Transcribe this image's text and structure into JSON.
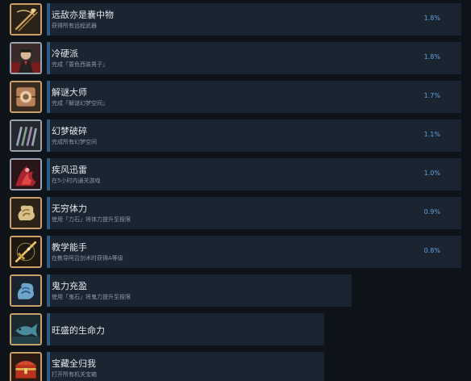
{
  "achievements": [
    {
      "title": "远敌亦是囊中物",
      "desc": "获得所有远程武器",
      "percent": "1.8%",
      "icon": "bow-weapons-icon"
    },
    {
      "title": "冷硬派",
      "desc": "完成「蔷色西装男子」",
      "percent": "1.8%",
      "icon": "man-in-suit-icon"
    },
    {
      "title": "解谜大师",
      "desc": "完成「解谜幻梦空间」",
      "percent": "1.7%",
      "icon": "puzzle-box-icon"
    },
    {
      "title": "幻梦破碎",
      "desc": "完成所有幻梦空间",
      "percent": "1.1%",
      "icon": "crystal-shards-icon"
    },
    {
      "title": "疾风迅雷",
      "desc": "在5小时内通关游戏",
      "percent": "1.0%",
      "icon": "red-flame-warrior-icon"
    },
    {
      "title": "无穷体力",
      "desc": "使用「力石」将体力提升至极限",
      "percent": "0.9%",
      "icon": "stamina-stone-icon"
    },
    {
      "title": "教学能手",
      "desc": "在教导阿吕剑术时获得A等级",
      "percent": "0.8%",
      "icon": "golden-sword-icon"
    },
    {
      "title": "鬼力充盈",
      "desc": "使用「鬼石」将鬼力提升至极限",
      "percent": "",
      "icon": "spirit-stone-icon"
    },
    {
      "title": "旺盛的生命力",
      "desc": "",
      "percent": "",
      "icon": "fish-icon"
    },
    {
      "title": "宝藏全归我",
      "desc": "打开所有机关宝箱",
      "percent": "",
      "icon": "treasure-chest-icon"
    }
  ]
}
